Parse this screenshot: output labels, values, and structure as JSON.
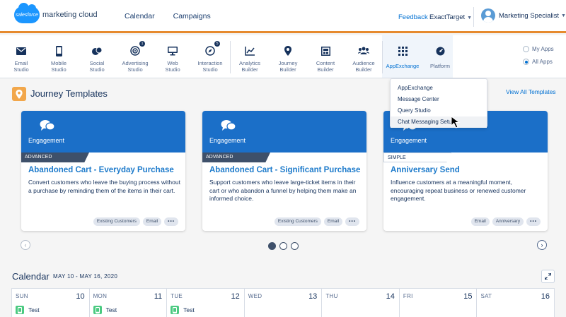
{
  "header": {
    "logo_mark": "salesforce",
    "logo_text": "marketing cloud",
    "nav": [
      "Calendar",
      "Campaigns"
    ],
    "feedback": "Feedback",
    "account": "ExactTarget",
    "user": "Marketing Specialist",
    "accent_color": "#e68a2e"
  },
  "apps": [
    {
      "label_1": "Email",
      "label_2": "Studio",
      "icon": "envelope-icon"
    },
    {
      "label_1": "Mobile",
      "label_2": "Studio",
      "icon": "mobile-icon"
    },
    {
      "label_1": "Social",
      "label_2": "Studio",
      "icon": "social-icon"
    },
    {
      "label_1": "Advertising",
      "label_2": "Studio",
      "icon": "advertising-icon",
      "badge": "1"
    },
    {
      "label_1": "Web",
      "label_2": "Studio",
      "icon": "monitor-icon"
    },
    {
      "label_1": "Interaction",
      "label_2": "Studio",
      "icon": "compass-icon",
      "badge": "5"
    },
    {
      "label_1": "Analytics",
      "label_2": "Builder",
      "icon": "chart-icon"
    },
    {
      "label_1": "Journey",
      "label_2": "Builder",
      "icon": "location-pin-icon"
    },
    {
      "label_1": "Content",
      "label_2": "Builder",
      "icon": "content-icon"
    },
    {
      "label_1": "Audience",
      "label_2": "Builder",
      "icon": "users-icon"
    },
    {
      "label_1": "AppExchange",
      "label_2": "",
      "icon": "app-grid-icon"
    },
    {
      "label_1": "Platform",
      "label_2": "",
      "icon": "gauge-icon"
    }
  ],
  "app_filter": {
    "my_apps": "My Apps",
    "all_apps": "All Apps"
  },
  "appexchange_menu": [
    "AppExchange",
    "Message Center",
    "Query Studio",
    "Chat Messaging Setup"
  ],
  "journey": {
    "title": "Journey Templates",
    "view_all": "View All Templates",
    "cards": [
      {
        "category": "Engagement",
        "level": "ADVANCED",
        "title": "Abandoned Cart - Everyday Purchase",
        "desc": "Convert customers who leave the buying process without a purchase by reminding them of the items in their cart.",
        "tags": [
          "Existing Customers",
          "Email",
          "•••"
        ]
      },
      {
        "category": "Engagement",
        "level": "ADVANCED",
        "title": "Abandoned Cart - Significant Purchase",
        "desc": "Support customers who leave large-ticket items in their cart or who abandon a funnel by helping them make an informed choice.",
        "tags": [
          "Existing Customers",
          "Email",
          "•••"
        ]
      },
      {
        "category": "Engagement",
        "level": "SIMPLE",
        "title": "Anniversary Send",
        "desc": "Influence customers at a meaningful moment, encouraging repeat business or renewed customer engagement.",
        "tags": [
          "Email",
          "Anniversary",
          "•••"
        ]
      }
    ],
    "prev": "‹",
    "next": "›",
    "current_page": 1,
    "page_count": 3
  },
  "calendar": {
    "title": "Calendar",
    "range": "MAY 10 - MAY 16, 2020",
    "days": [
      {
        "name": "SUN",
        "date": "10",
        "event": "Test"
      },
      {
        "name": "MON",
        "date": "11",
        "event": "Test"
      },
      {
        "name": "TUE",
        "date": "12",
        "event": "Test"
      },
      {
        "name": "WED",
        "date": "13",
        "event": ""
      },
      {
        "name": "THU",
        "date": "14",
        "event": ""
      },
      {
        "name": "FRI",
        "date": "15",
        "event": ""
      },
      {
        "name": "SAT",
        "date": "16",
        "event": ""
      }
    ]
  }
}
